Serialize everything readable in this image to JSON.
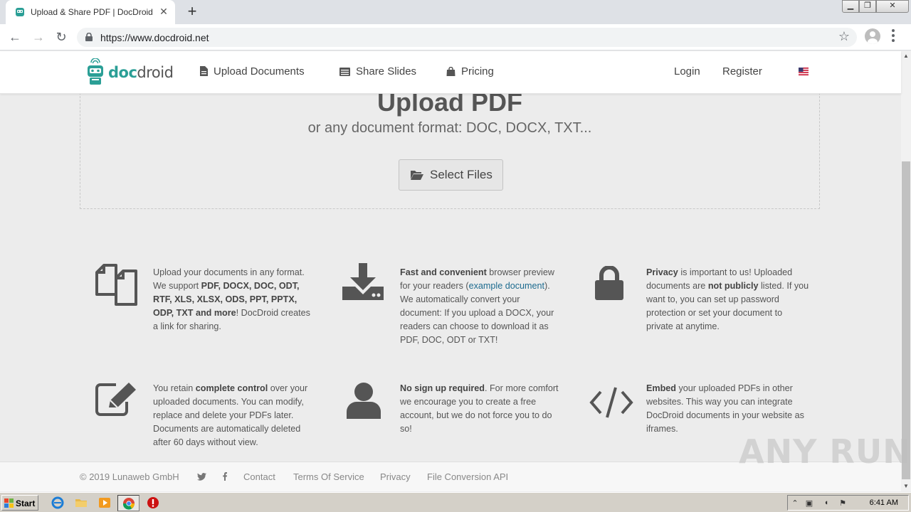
{
  "browser": {
    "tab_title": "Upload & Share PDF | DocDroid",
    "tab_close": "✕",
    "new_tab": "+",
    "url": "https://www.docdroid.net",
    "window_controls": {
      "minimize": "▁",
      "maximize": "❐",
      "close": "✕"
    },
    "back": "←",
    "forward": "→",
    "reload": "↻",
    "bookmark": "☆"
  },
  "navbar": {
    "logo_doc": "doc",
    "logo_droid": "droid",
    "items": [
      {
        "label": "Upload Documents",
        "icon": "file-icon"
      },
      {
        "label": "Share Slides",
        "icon": "slides-icon"
      },
      {
        "label": "Pricing",
        "icon": "shopping-bag-icon"
      }
    ],
    "login": "Login",
    "register": "Register",
    "language_flag": "us-flag-icon"
  },
  "upload": {
    "title": "Upload PDF",
    "subtitle": "or any document format: DOC, DOCX, TXT...",
    "button": "Select Files"
  },
  "features": [
    {
      "icon": "copy-files-icon",
      "parts": [
        {
          "t": "Upload your documents in any format. We support "
        },
        {
          "t": "PDF, DOCX, DOC, ODT, RTF, XLS, XLSX, ODS, PPT, PPTX, ODP, TXT and more",
          "b": true
        },
        {
          "t": "! DocDroid creates a link for sharing."
        }
      ]
    },
    {
      "icon": "download-icon",
      "parts": [
        {
          "t": "Fast and convenient",
          "b": true
        },
        {
          "t": " browser preview for your readers ("
        },
        {
          "t": "example document",
          "a": true
        },
        {
          "t": "). We automatically convert your document: If you upload a DOCX, your readers can choose to download it as PDF, DOC, ODT or TXT!"
        }
      ]
    },
    {
      "icon": "lock-icon",
      "parts": [
        {
          "t": "Privacy",
          "b": true
        },
        {
          "t": " is important to us! Uploaded documents are "
        },
        {
          "t": "not publicly",
          "b": true
        },
        {
          "t": " listed. If you want to, you can set up password protection or set your document to private at anytime."
        }
      ]
    },
    {
      "icon": "edit-icon",
      "parts": [
        {
          "t": "You retain "
        },
        {
          "t": "complete control",
          "b": true
        },
        {
          "t": " over your uploaded documents. You can modify, replace and delete your PDFs later. Documents are automatically deleted after 60 days without view."
        }
      ]
    },
    {
      "icon": "user-icon",
      "parts": [
        {
          "t": "No sign up required",
          "b": true
        },
        {
          "t": ". For more comfort we encourage you to create a free account, but we do not force you to do so!"
        }
      ]
    },
    {
      "icon": "code-icon",
      "parts": [
        {
          "t": "Embed",
          "b": true
        },
        {
          "t": " your uploaded PDFs in other websites. This way you can integrate DocDroid documents in your website as iframes."
        }
      ]
    }
  ],
  "footer": {
    "copyright": "© 2019 Lunaweb GmbH",
    "links": [
      "Contact",
      "Terms Of Service",
      "Privacy",
      "File Conversion API"
    ]
  },
  "watermark": "ANY RUN",
  "taskbar": {
    "start": "Start",
    "clock": "6:41 AM"
  }
}
